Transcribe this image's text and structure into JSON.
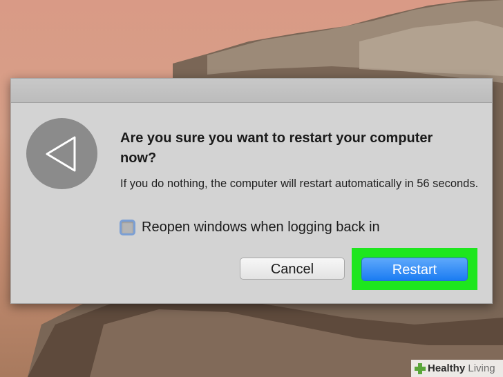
{
  "dialog": {
    "heading": "Are you sure you want to restart your computer now?",
    "message": "If you do nothing, the computer will restart automatically in 56 seconds.",
    "checkbox": {
      "label": "Reopen windows when logging back in",
      "checked": false
    },
    "buttons": {
      "cancel": "Cancel",
      "restart": "Restart"
    },
    "icon": "restart-triangle-icon"
  },
  "highlight_color": "#1ee61e",
  "watermark": {
    "brand": "Healthy",
    "suffix": " Living"
  }
}
